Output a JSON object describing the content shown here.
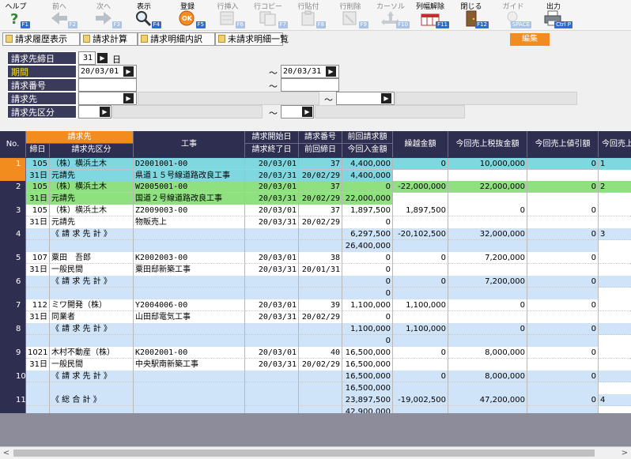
{
  "toolbar": {
    "help": {
      "label": "ヘルプ",
      "key": "F1"
    },
    "prev": {
      "label": "前へ",
      "key": "F2"
    },
    "next": {
      "label": "次へ",
      "key": "F3"
    },
    "display": {
      "label": "表示",
      "key": "F4"
    },
    "register": {
      "label": "登録",
      "key": "F5"
    },
    "row_insert": {
      "label": "行挿入",
      "key": "F6"
    },
    "row_copy": {
      "label": "行コピー",
      "key": "F7"
    },
    "row_paste": {
      "label": "行貼付",
      "key": "F8"
    },
    "row_delete": {
      "label": "行削除",
      "key": "F9"
    },
    "cursor": {
      "label": "カーソル",
      "key": "F10"
    },
    "col_unfix": {
      "label": "列幅解除",
      "key": "F11"
    },
    "close": {
      "label": "閉じる",
      "key": "F12"
    },
    "guide": {
      "label": "ガイド",
      "key": "SPACE"
    },
    "output": {
      "label": "出力",
      "key": "Ctrl P"
    }
  },
  "tabs": [
    "請求履歴表示",
    "請求計算",
    "請求明細内訳",
    "未請求明細一覧"
  ],
  "edit_tab": "編集",
  "filters": {
    "closing_day": {
      "label": "請求先締日",
      "value": "31",
      "unit": "日"
    },
    "period": {
      "label": "期間",
      "from": "20/03/01",
      "to": "20/03/31"
    },
    "invoice_no": {
      "label": "請求番号"
    },
    "billing_to": {
      "label": "請求先"
    },
    "billing_type": {
      "label": "請求先区分"
    },
    "tilde": "～"
  },
  "grid": {
    "headers": {
      "no": "No.",
      "billing_to": "請求先",
      "closing": "締日",
      "billing_type": "請求先区分",
      "work": "工事",
      "start": "請求開始日",
      "end": "請求終了日",
      "inv_no": "請求番号",
      "prev_closing": "前回締日",
      "prev_amount": "前回請求額",
      "prev_received": "今回入金額",
      "carryover": "繰越金額",
      "sales_ex_tax": "今回売上税抜金額",
      "sales_discount": "今回売上値引額",
      "sales_more": "今回売上"
    },
    "rows": [
      {
        "no": "1",
        "l1": [
          "105",
          "（株）横浜土木",
          "D2001001-00",
          "20/03/01",
          "37",
          "4,400,000",
          "0",
          "10,000,000",
          "0",
          "1"
        ],
        "l2": [
          "31日",
          "元請先",
          "県道１５号線道路改良工事",
          "20/03/31",
          "20/02/29",
          "4,400,000",
          "",
          "",
          "",
          ""
        ],
        "style": "sel"
      },
      {
        "no": "2",
        "l1": [
          "105",
          "（株）横浜土木",
          "W2005001-00",
          "20/03/01",
          "37",
          "0",
          "-22,000,000",
          "22,000,000",
          "0",
          "2"
        ],
        "l2": [
          "31日",
          "元請先",
          "国道２号線道路改良工事",
          "20/03/31",
          "20/02/29",
          "22,000,000",
          "",
          "",
          "",
          ""
        ],
        "style": "green"
      },
      {
        "no": "3",
        "l1": [
          "105",
          "（株）横浜土木",
          "Z2009003-00",
          "20/03/01",
          "37",
          "1,897,500",
          "1,897,500",
          "0",
          "0",
          ""
        ],
        "l2": [
          "31日",
          "元請先",
          "物販売上",
          "20/03/31",
          "20/02/29",
          "0",
          "",
          "",
          "",
          ""
        ],
        "style": "white"
      },
      {
        "no": "4",
        "l1": [
          "",
          "《 請 求 先 計 》",
          "",
          "",
          "",
          "6,297,500",
          "-20,102,500",
          "32,000,000",
          "0",
          "3"
        ],
        "l2": [
          "",
          "",
          "",
          "",
          "",
          "26,400,000",
          "",
          "",
          "",
          ""
        ],
        "style": "blue"
      },
      {
        "no": "5",
        "l1": [
          "107",
          "粟田　吾郎",
          "K2002003-00",
          "20/03/01",
          "38",
          "0",
          "0",
          "7,200,000",
          "0",
          ""
        ],
        "l2": [
          "31日",
          "一般民間",
          "粟田邸新築工事",
          "20/03/31",
          "20/01/31",
          "0",
          "",
          "",
          "",
          ""
        ],
        "style": "white"
      },
      {
        "no": "6",
        "l1": [
          "",
          "《 請 求 先 計 》",
          "",
          "",
          "",
          "0",
          "0",
          "7,200,000",
          "0",
          ""
        ],
        "l2": [
          "",
          "",
          "",
          "",
          "",
          "0",
          "",
          "",
          "",
          ""
        ],
        "style": "blue"
      },
      {
        "no": "7",
        "l1": [
          "112",
          "ミワ開発（株）",
          "Y2004006-00",
          "20/03/01",
          "39",
          "1,100,000",
          "1,100,000",
          "0",
          "0",
          ""
        ],
        "l2": [
          "31日",
          "同業者",
          "山田邸電気工事",
          "20/03/31",
          "20/02/29",
          "0",
          "",
          "",
          "",
          ""
        ],
        "style": "white"
      },
      {
        "no": "8",
        "l1": [
          "",
          "《 請 求 先 計 》",
          "",
          "",
          "",
          "1,100,000",
          "1,100,000",
          "0",
          "0",
          ""
        ],
        "l2": [
          "",
          "",
          "",
          "",
          "",
          "0",
          "",
          "",
          "",
          ""
        ],
        "style": "blue"
      },
      {
        "no": "9",
        "l1": [
          "1021",
          "木村不動産（株）",
          "K2002001-00",
          "20/03/01",
          "40",
          "16,500,000",
          "0",
          "8,000,000",
          "0",
          ""
        ],
        "l2": [
          "31日",
          "一般民間",
          "中央駅南新築工事",
          "20/03/31",
          "20/02/29",
          "16,500,000",
          "",
          "",
          "",
          ""
        ],
        "style": "white"
      },
      {
        "no": "10",
        "l1": [
          "",
          "《 請 求 先 計 》",
          "",
          "",
          "",
          "16,500,000",
          "0",
          "8,000,000",
          "0",
          ""
        ],
        "l2": [
          "",
          "",
          "",
          "",
          "",
          "16,500,000",
          "",
          "",
          "",
          ""
        ],
        "style": "blue"
      },
      {
        "no": "11",
        "l1": [
          "",
          "《 総 合 計 》",
          "",
          "",
          "",
          "23,897,500",
          "-19,002,500",
          "47,200,000",
          "0",
          "4"
        ],
        "l2": [
          "",
          "",
          "",
          "",
          "",
          "42,900,000",
          "",
          "",
          "",
          ""
        ],
        "style": "blue"
      }
    ]
  },
  "colors": {
    "accent": "#f28c1e",
    "header": "#2e2e50",
    "selected_row": "#7fd8e0",
    "green_row": "#8fe07f",
    "subtotal_row": "#cfe4f8",
    "fkey": "#2b6cd8"
  }
}
